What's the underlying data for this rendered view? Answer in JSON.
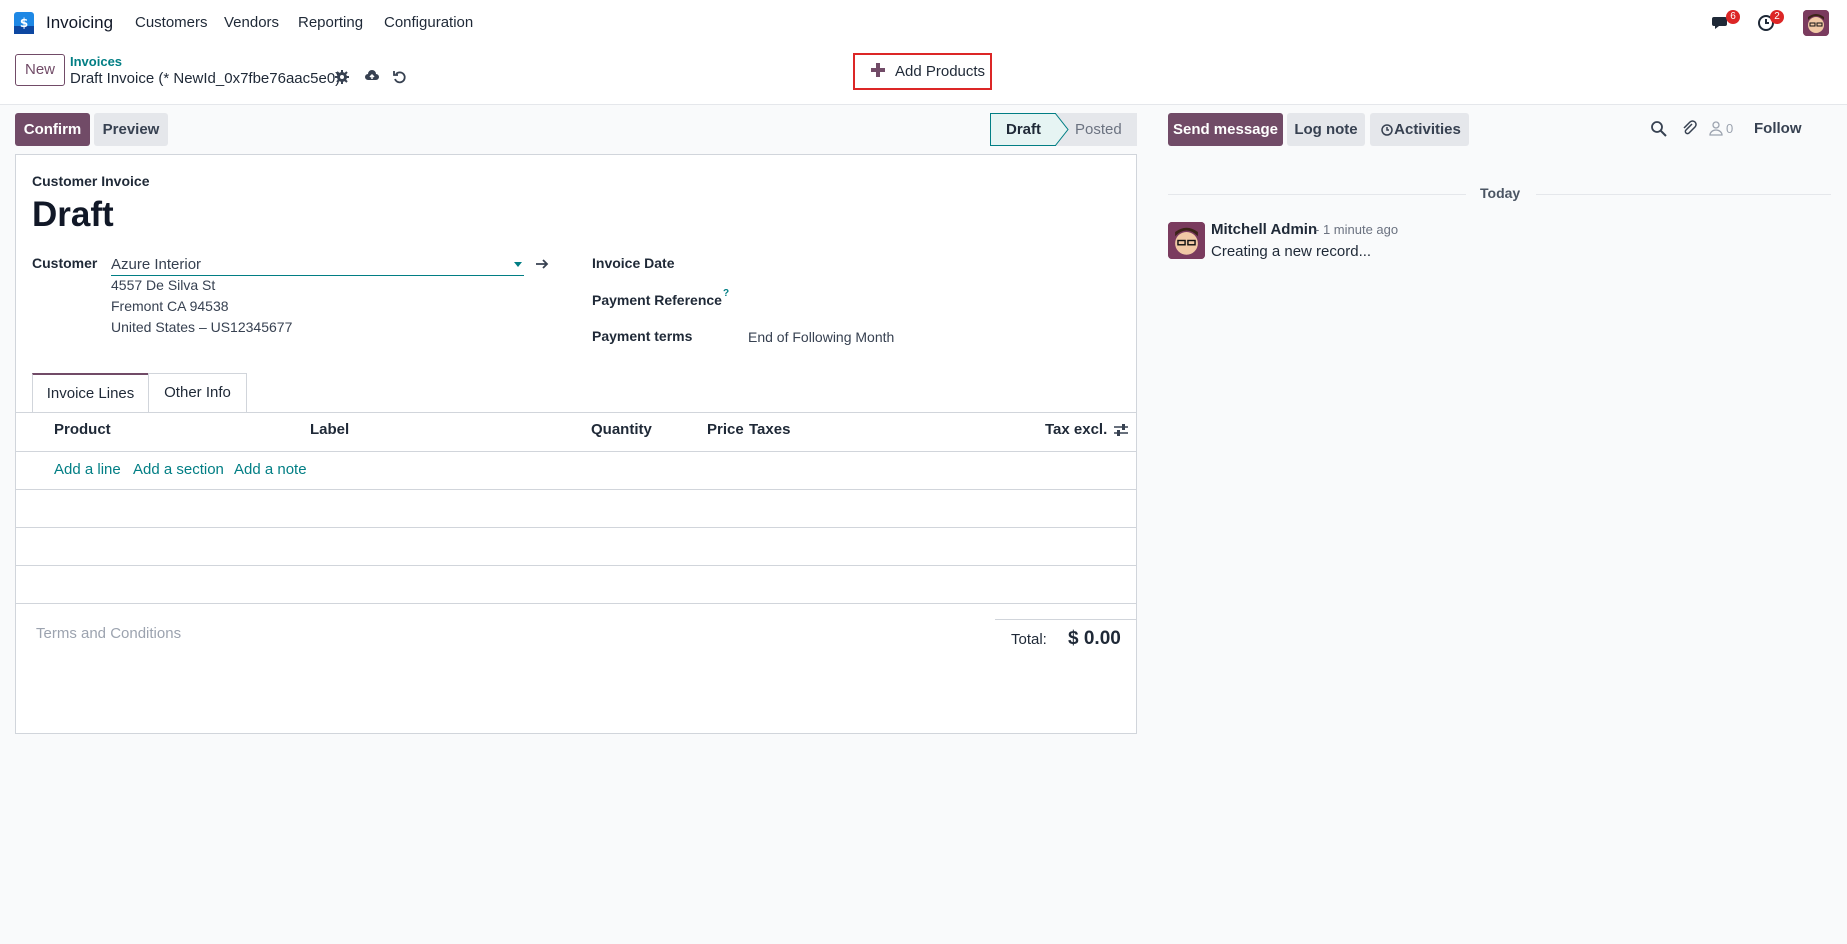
{
  "navbar": {
    "app_name": "Invoicing",
    "menu": [
      "Customers",
      "Vendors",
      "Reporting",
      "Configuration"
    ],
    "messages_badge": "6",
    "activities_badge": "2"
  },
  "control": {
    "new_label": "New",
    "breadcrumb_link": "Invoices",
    "record_title": "Draft Invoice (* NewId_0x7fbe76aac5e0)",
    "add_products_label": "Add Products"
  },
  "actions": {
    "confirm": "Confirm",
    "preview": "Preview"
  },
  "status": {
    "steps": [
      "Draft",
      "Posted"
    ],
    "current": "Draft"
  },
  "form": {
    "subtitle": "Customer Invoice",
    "title": "Draft",
    "customer_label": "Customer",
    "customer_value": "Azure Interior",
    "address": [
      "4557 De Silva St",
      "Fremont CA 94538",
      "United States – US12345677"
    ],
    "invoice_date_label": "Invoice Date",
    "payment_reference_label": "Payment Reference",
    "help_mark": "?",
    "payment_terms_label": "Payment terms",
    "payment_terms_value": "End of Following Month",
    "tabs": [
      "Invoice Lines",
      "Other Info"
    ],
    "columns": [
      "Product",
      "Label",
      "Quantity",
      "Price",
      "Taxes",
      "Tax excl."
    ],
    "add_links": [
      "Add a line",
      "Add a section",
      "Add a note"
    ],
    "terms_placeholder": "Terms and Conditions",
    "total_label": "Total:",
    "total_value": "$ 0.00"
  },
  "chatter": {
    "send_message": "Send message",
    "log_note": "Log note",
    "activities": "Activities",
    "followers_count": "0",
    "follow": "Follow",
    "today": "Today",
    "message": {
      "author": "Mitchell Admin",
      "time": "- 1 minute ago",
      "body": "Creating a new record..."
    }
  },
  "colors": {
    "brand": "#714b67",
    "link": "#017e84",
    "highlight_border": "#dc2626"
  },
  "icons": [
    "app-logo-icon",
    "chat-icon",
    "clock-icon",
    "gear-icon",
    "cloud-upload-icon",
    "undo-icon",
    "plus-icon",
    "caret-down-icon",
    "arrow-right-icon",
    "sliders-icon",
    "search-icon",
    "paperclip-icon",
    "user-icon"
  ]
}
